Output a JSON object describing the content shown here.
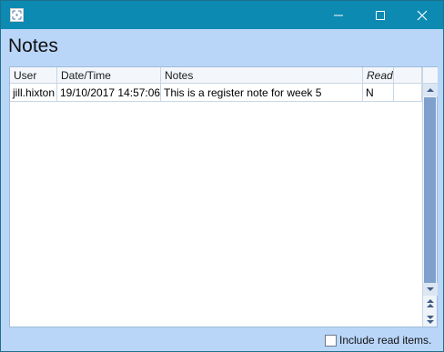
{
  "window": {
    "heading": "Notes"
  },
  "grid": {
    "columns": [
      "User",
      "Date/Time",
      "Notes",
      "Read",
      ""
    ],
    "rows": [
      {
        "user": "jill.hixton",
        "datetime": "19/10/2017 14:57:06",
        "note": "This is a register note for week 5",
        "read": "N",
        "extra": ""
      }
    ]
  },
  "footer": {
    "include_read_label": "Include read items.",
    "include_read_checked": false
  },
  "colors": {
    "titlebar": "#0c8ab2",
    "window_background": "#b9d6f9",
    "scroll_thumb": "#7fa0cc"
  },
  "icons": {
    "app": "app-icon",
    "minimize": "minimize-icon",
    "maximize": "maximize-icon",
    "close": "close-icon"
  }
}
